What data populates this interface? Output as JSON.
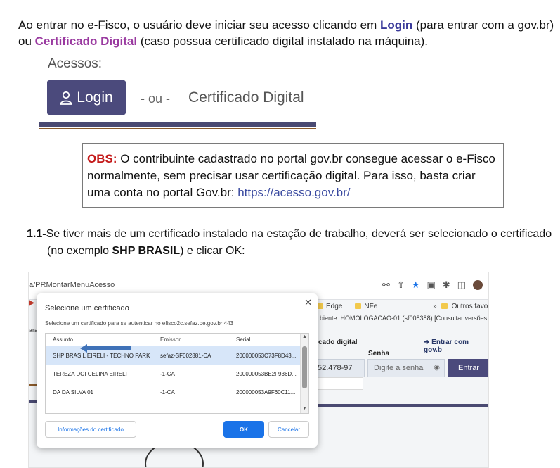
{
  "intro": {
    "part1": "Ao entrar no e-Fisco, o usuário deve iniciar seu acesso clicando em ",
    "login_kw": "Login",
    "part2": " (para entrar com a gov.br) ou ",
    "cert_kw": "Certificado Digital",
    "part3": " (caso possua certificado digital instalado na máquina)."
  },
  "access": {
    "label": "Acessos:",
    "login_button": "Login",
    "or_text": "- ou -",
    "cert_link": "Certificado Digital"
  },
  "obs": {
    "tag": "OBS:",
    "text": " O contribuinte cadastrado no portal gov.br consegue acessar o e-Fisco normalmente, sem precisar usar certificação digital. Para isso, basta criar uma conta no portal Gov.br: ",
    "link": "https://acesso.gov.br/"
  },
  "step": {
    "number": "1.1-",
    "text1": "Se tiver mais de um certificado instalado na estação de trabalho, deverá ser selecionado o certificado (no exemplo ",
    "highlight": "SHP BRASIL",
    "text2": ") e clicar OK:"
  },
  "screenshot": {
    "url": "a/PRMontarMenuAcesso",
    "bookmarks": [
      "Edge",
      "NFe"
    ],
    "bookmark_more": "»",
    "bookmark_other": "Outros favo",
    "env_line": "biente: HOMOLOGACAO-01 (sf008388)  [Consultar versões",
    "bg_cad": "cado digital",
    "bg_entrar_gov": "Entrar com gov.b",
    "senha_label": "Senha",
    "cpf_value": "52.478-97",
    "senha_placeholder": "Digite a senha",
    "entrar_button": "Entrar",
    "bg_ara": "ara",
    "dialog": {
      "title": "Selecione um certificado",
      "subtitle": "Selecione um certificado para se autenticar no efisco2c.sefaz.pe.gov.br:443",
      "columns": [
        "Assunto",
        "Emissor",
        "Serial"
      ],
      "rows": [
        {
          "subject": "SHP BRASIL EIRELI - TECHNO PARK",
          "issuer": "sefaz-SF002881-CA",
          "serial": "200000053C73F8D43..."
        },
        {
          "subject": "TEREZA DOI    CELINA EIRELI",
          "issuer": "         -1-CA",
          "serial": "200000053BE2F936D..."
        },
        {
          "subject": "                       DA DA SILVA 01",
          "issuer": "         -1-CA",
          "serial": "200000053A9F60C11..."
        },
        {
          "subject": "",
          "issuer": "",
          "serial": ""
        }
      ],
      "info_button": "Informações do certificado",
      "ok_button": "OK",
      "cancel_button": "Cancelar"
    }
  }
}
